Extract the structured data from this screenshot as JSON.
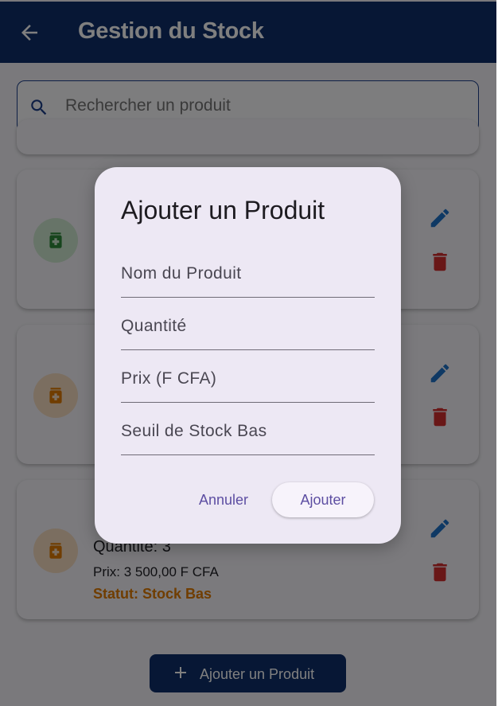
{
  "appbar": {
    "title": "Gestion du Stock",
    "back_icon": "arrow-back-icon"
  },
  "search": {
    "placeholder": "Rechercher un produit",
    "icon": "search-icon"
  },
  "cards": [
    {
      "avatar_color": "#2e8b3a",
      "avatar_icon": "medical-bottle-icon"
    },
    {
      "avatar_color": "#e07b00",
      "avatar_icon": "medical-bottle-icon"
    },
    {
      "avatar_color": "#e07b00",
      "avatar_icon": "medical-bottle-icon",
      "quantity": "Quantité: 3",
      "price": "Prix: 3 500,00 F CFA",
      "status": "Statut: Stock Bas"
    }
  ],
  "colors": {
    "primary": "#0f2f6b",
    "edit": "#1e73c9",
    "delete": "#d32f2f",
    "warning": "#e07b00",
    "accent": "#5d4ea2"
  },
  "add_button": {
    "label": "Ajouter un Produit",
    "icon": "plus-icon"
  },
  "dialog": {
    "title": "Ajouter un Produit",
    "fields": {
      "name": {
        "placeholder": "Nom du Produit",
        "value": ""
      },
      "quantity": {
        "placeholder": "Quantité",
        "value": ""
      },
      "price": {
        "placeholder": "Prix (F CFA)",
        "value": ""
      },
      "threshold": {
        "placeholder": "Seuil de Stock Bas",
        "value": ""
      }
    },
    "cancel_label": "Annuler",
    "confirm_label": "Ajouter"
  }
}
